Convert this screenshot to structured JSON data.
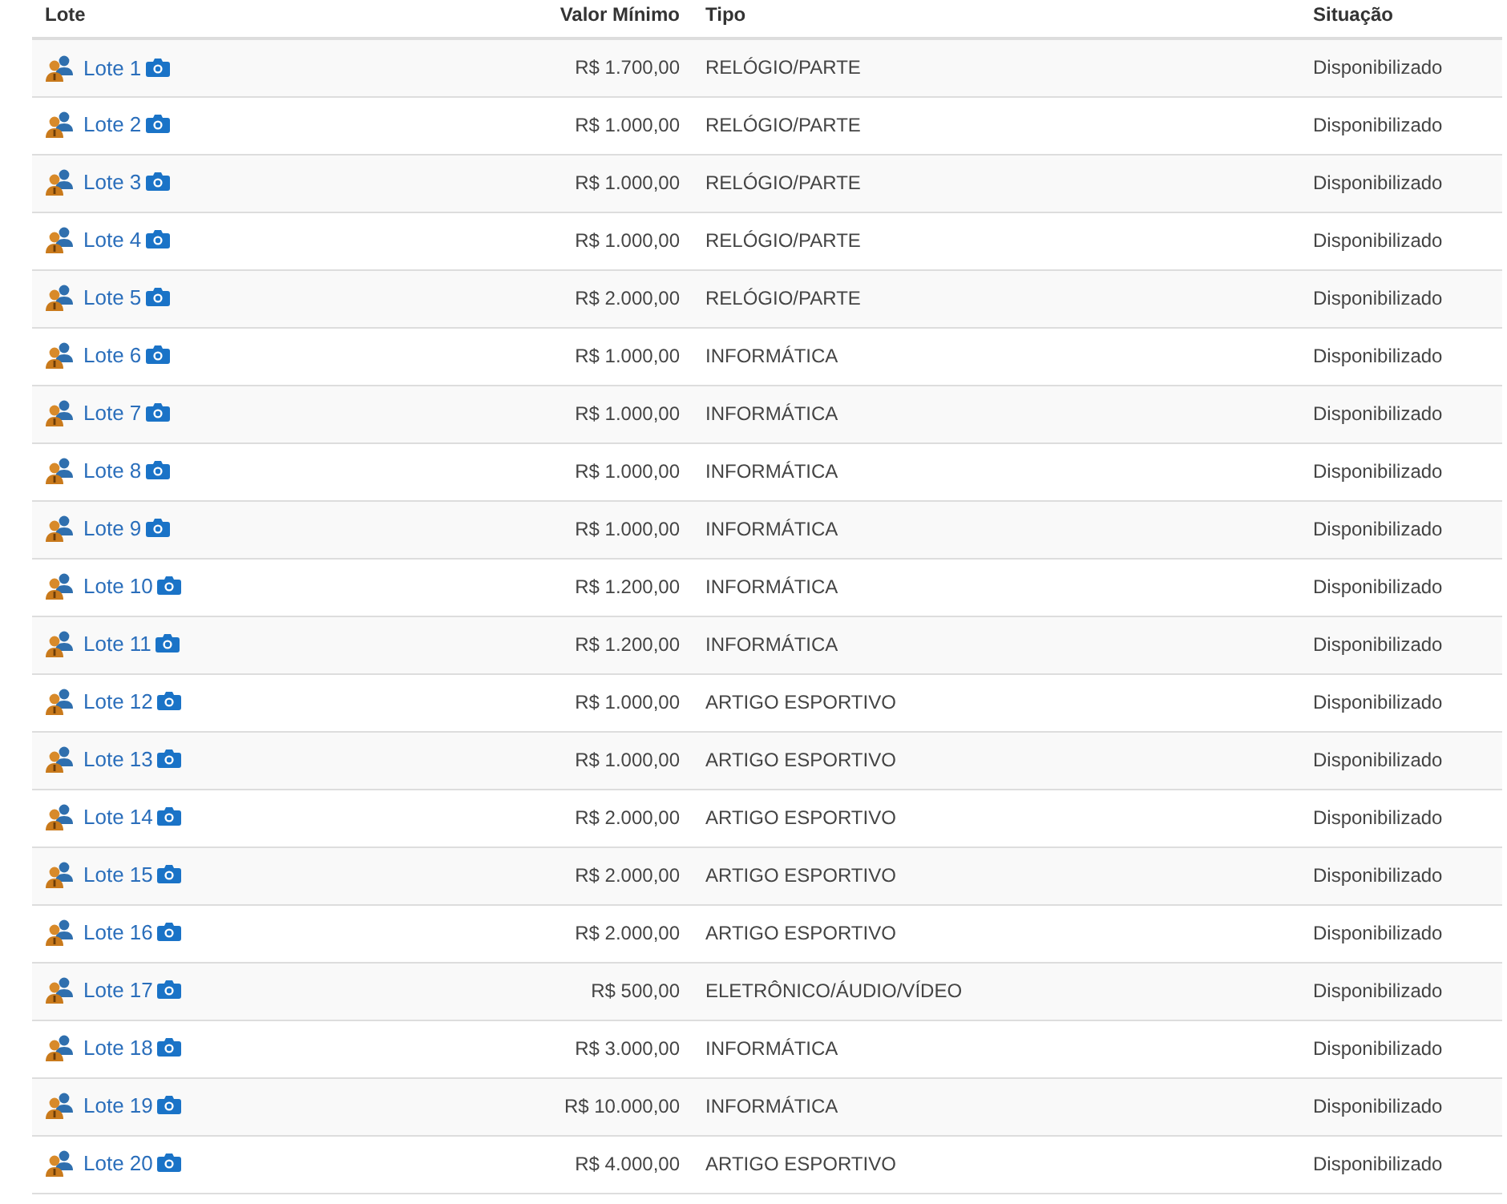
{
  "table": {
    "columns": [
      "Lote",
      "Valor Mínimo",
      "Tipo",
      "Situação"
    ],
    "rows": [
      {
        "lote": "Lote 1",
        "valor": "R$ 1.700,00",
        "tipo": "RELÓGIO/PARTE",
        "situacao": "Disponibilizado"
      },
      {
        "lote": "Lote 2",
        "valor": "R$ 1.000,00",
        "tipo": "RELÓGIO/PARTE",
        "situacao": "Disponibilizado"
      },
      {
        "lote": "Lote 3",
        "valor": "R$ 1.000,00",
        "tipo": "RELÓGIO/PARTE",
        "situacao": "Disponibilizado"
      },
      {
        "lote": "Lote 4",
        "valor": "R$ 1.000,00",
        "tipo": "RELÓGIO/PARTE",
        "situacao": "Disponibilizado"
      },
      {
        "lote": "Lote 5",
        "valor": "R$ 2.000,00",
        "tipo": "RELÓGIO/PARTE",
        "situacao": "Disponibilizado"
      },
      {
        "lote": "Lote 6",
        "valor": "R$ 1.000,00",
        "tipo": "INFORMÁTICA",
        "situacao": "Disponibilizado"
      },
      {
        "lote": "Lote 7",
        "valor": "R$ 1.000,00",
        "tipo": "INFORMÁTICA",
        "situacao": "Disponibilizado"
      },
      {
        "lote": "Lote 8",
        "valor": "R$ 1.000,00",
        "tipo": "INFORMÁTICA",
        "situacao": "Disponibilizado"
      },
      {
        "lote": "Lote 9",
        "valor": "R$ 1.000,00",
        "tipo": "INFORMÁTICA",
        "situacao": "Disponibilizado"
      },
      {
        "lote": "Lote 10",
        "valor": "R$ 1.200,00",
        "tipo": "INFORMÁTICA",
        "situacao": "Disponibilizado"
      },
      {
        "lote": "Lote 11",
        "valor": "R$ 1.200,00",
        "tipo": "INFORMÁTICA",
        "situacao": "Disponibilizado"
      },
      {
        "lote": "Lote 12",
        "valor": "R$ 1.000,00",
        "tipo": "ARTIGO ESPORTIVO",
        "situacao": "Disponibilizado"
      },
      {
        "lote": "Lote 13",
        "valor": "R$ 1.000,00",
        "tipo": "ARTIGO ESPORTIVO",
        "situacao": "Disponibilizado"
      },
      {
        "lote": "Lote 14",
        "valor": "R$ 2.000,00",
        "tipo": "ARTIGO ESPORTIVO",
        "situacao": "Disponibilizado"
      },
      {
        "lote": "Lote 15",
        "valor": "R$ 2.000,00",
        "tipo": "ARTIGO ESPORTIVO",
        "situacao": "Disponibilizado"
      },
      {
        "lote": "Lote 16",
        "valor": "R$ 2.000,00",
        "tipo": "ARTIGO ESPORTIVO",
        "situacao": "Disponibilizado"
      },
      {
        "lote": "Lote 17",
        "valor": "R$ 500,00",
        "tipo": "ELETRÔNICO/ÁUDIO/VÍDEO",
        "situacao": "Disponibilizado"
      },
      {
        "lote": "Lote 18",
        "valor": "R$ 3.000,00",
        "tipo": "INFORMÁTICA",
        "situacao": "Disponibilizado"
      },
      {
        "lote": "Lote 19",
        "valor": "R$ 10.000,00",
        "tipo": "INFORMÁTICA",
        "situacao": "Disponibilizado"
      },
      {
        "lote": "Lote 20",
        "valor": "R$ 4.000,00",
        "tipo": "ARTIGO ESPORTIVO",
        "situacao": "Disponibilizado"
      }
    ]
  }
}
